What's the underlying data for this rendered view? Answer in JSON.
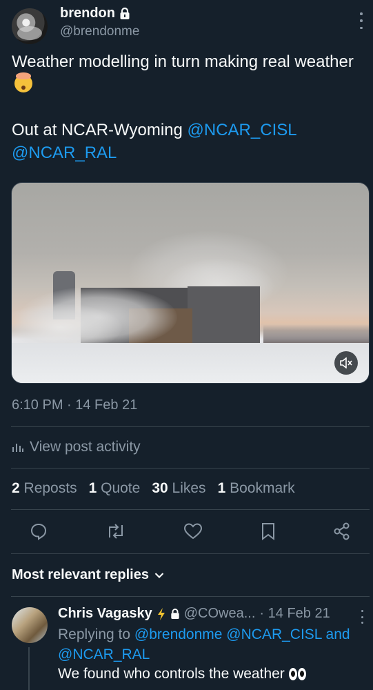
{
  "author": {
    "name": "brendon",
    "handle": "@brendonme"
  },
  "tweet": {
    "line1": "Weather modelling in turn making real weather",
    "line2_prefix": "Out at NCAR-Wyoming ",
    "mention1": "@NCAR_CISL",
    "mention2": "@NCAR_RAL"
  },
  "timestamp": "6:10 PM · 14 Feb 21",
  "activity_label": "View post activity",
  "stats": {
    "reposts_count": "2",
    "reposts_label": "Reposts",
    "quotes_count": "1",
    "quotes_label": "Quote",
    "likes_count": "30",
    "likes_label": "Likes",
    "bookmarks_count": "1",
    "bookmarks_label": "Bookmark"
  },
  "replies_header": "Most relevant replies",
  "reply": {
    "name": "Chris Vagasky",
    "handle": "@COwea...",
    "date": "· 14 Feb 21",
    "replying_prefix": "Replying to ",
    "replying_to": "@brendonme @NCAR_CISL and @NCAR_RAL",
    "text": "We found who controls the weather"
  },
  "icons": [
    "lock-icon",
    "more-icon",
    "mute-icon",
    "activity-icon",
    "reply-icon",
    "repost-icon",
    "like-icon",
    "bookmark-icon",
    "share-icon",
    "chevron-down-icon",
    "lightning-icon",
    "eyes-emoji",
    "mind-blown-emoji"
  ],
  "colors": {
    "background": "#15202b",
    "accent": "#1d9bf0",
    "muted": "#8b98a5",
    "divider": "#38444d"
  }
}
